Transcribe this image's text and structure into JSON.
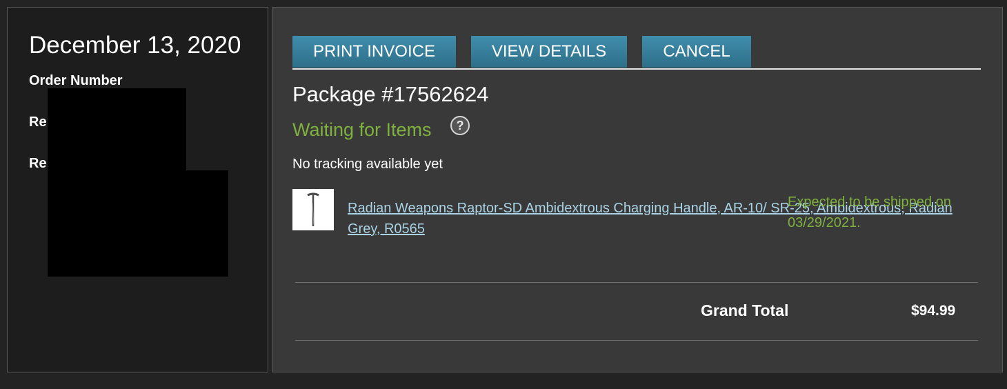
{
  "order": {
    "date": "December 13, 2020",
    "order_number_label": "Order Number",
    "row2_label_visible": "Re",
    "row3_label_visible": "Re"
  },
  "tabs": {
    "print_invoice": "PRINT INVOICE",
    "view_details": "VIEW DETAILS",
    "cancel": "CANCEL"
  },
  "package": {
    "title": "Package #17562624",
    "status": "Waiting for Items",
    "help_glyph": "?",
    "tracking": "No tracking available yet",
    "item": {
      "name": "Radian Weapons Raptor-SD Ambidextrous Charging Handle, AR-10/ SR-25, Ambidextrous, Radian Grey, R0565",
      "ship_note": "Expected to be shipped on 03/29/2021.",
      "thumbnail_icon": "charging-handle-icon"
    }
  },
  "totals": {
    "grand_total_label": "Grand Total",
    "grand_total_value": "$94.99"
  },
  "colors": {
    "status_green": "#7fb13f",
    "link_blue": "#a9d3e4",
    "tab_blue": "#3a86a6"
  }
}
